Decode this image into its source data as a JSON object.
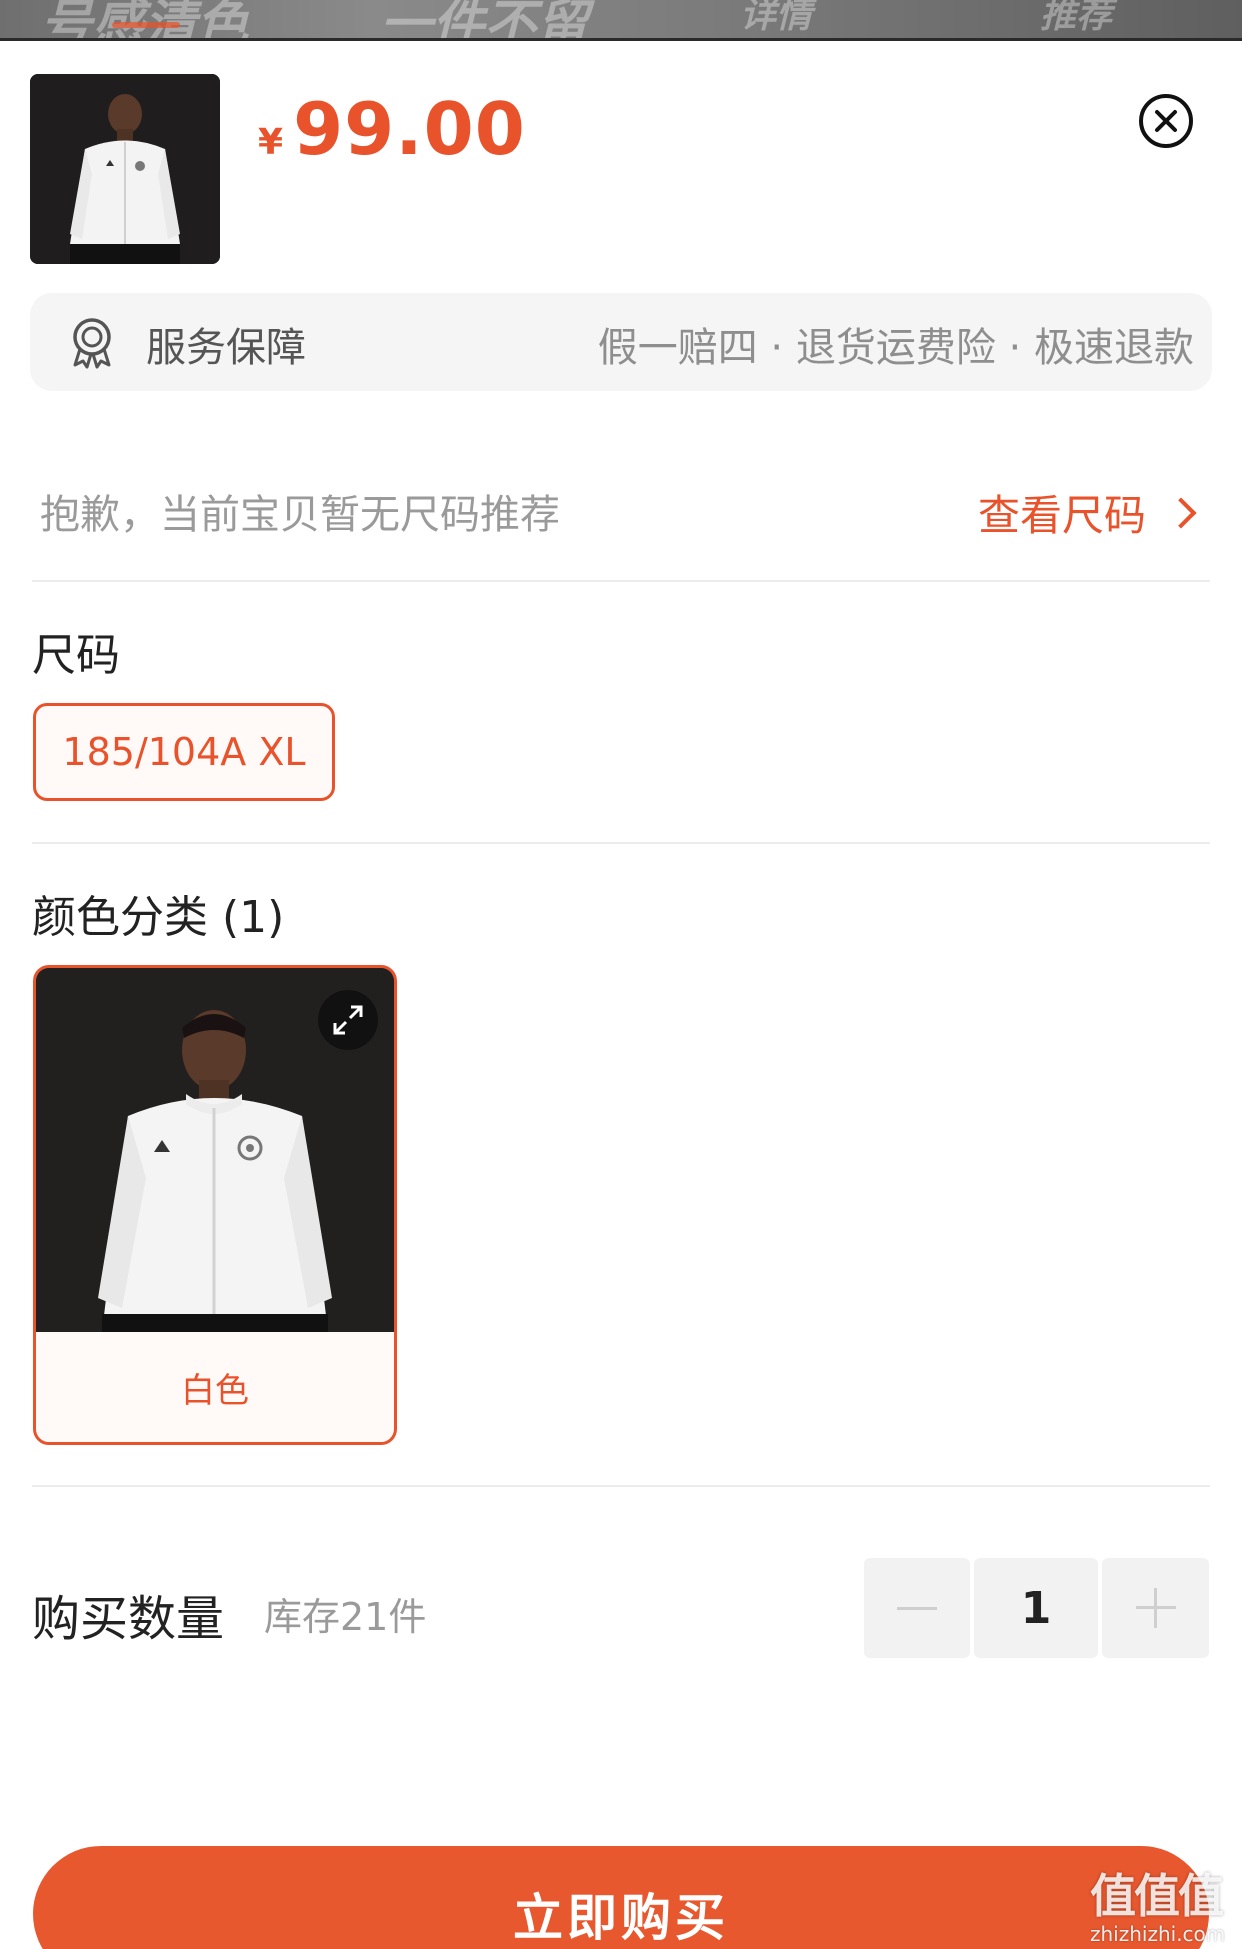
{
  "background_header": {
    "faded_text": [
      "号感清色",
      "一件不留",
      "详情",
      "推荐"
    ]
  },
  "product": {
    "image_icon": "jacket-model-photo",
    "currency_symbol": "¥",
    "price": "99.00",
    "close_icon": "close-circle-icon"
  },
  "service": {
    "icon": "award-badge-icon",
    "title": "服务保障",
    "detail": "假一赔四 · 退货运费险 · 极速退款"
  },
  "size_recommendation": {
    "tip": "抱歉，当前宝贝暂无尺码推荐",
    "link_label": "查看尺码"
  },
  "size_section": {
    "title": "尺码",
    "options": [
      {
        "label": "185/104A XL",
        "selected": true
      }
    ]
  },
  "color_section": {
    "title": "颜色分类 (1)",
    "options": [
      {
        "label": "白色",
        "selected": true,
        "icon": "expand-icon"
      }
    ]
  },
  "quantity": {
    "title": "购买数量",
    "stock": "库存21件",
    "value": "1"
  },
  "buy_button": {
    "label": "立即购买"
  },
  "watermark": {
    "main": "值值值",
    "sub": "zhizhizhi.com"
  },
  "colors": {
    "accent": "#e8532b",
    "buy_button": "#e8582f"
  }
}
